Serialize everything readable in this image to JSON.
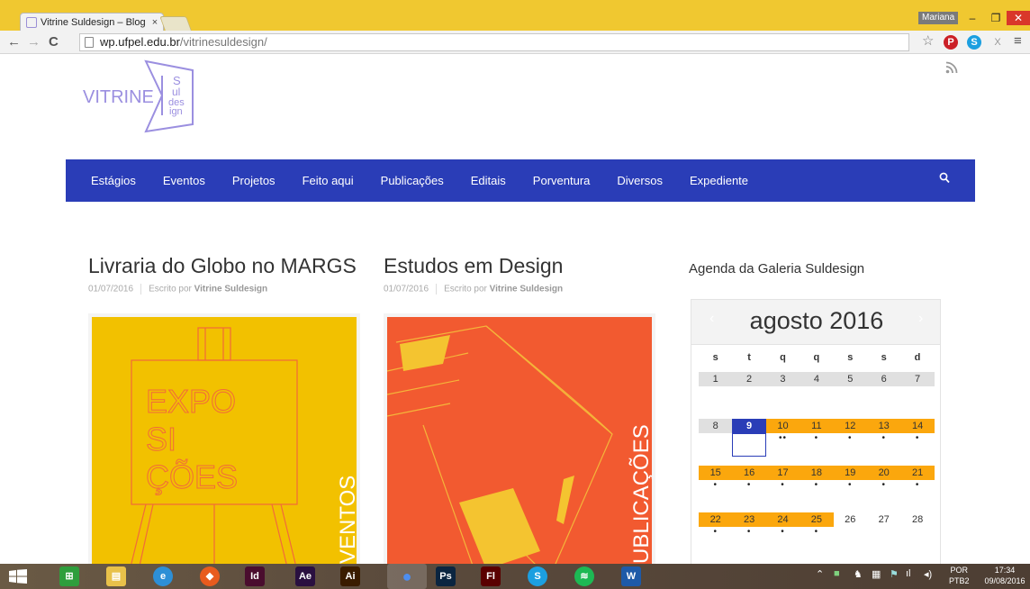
{
  "browser": {
    "tab_title": "Vitrine Suldesign – Blog d",
    "tab_close": "×",
    "user": "Mariana",
    "win_min": "‒",
    "win_max": "❐",
    "win_close": "✕",
    "back": "←",
    "forward": "→",
    "reload": "C",
    "url_host": "wp.ufpel.edu.br",
    "url_path": "/vitrinesuldesign/",
    "star": "☆",
    "ext_pinterest": "P",
    "ext_skype": "S",
    "ext_x": "X",
    "menu": "≡"
  },
  "site": {
    "logo_word": "VITRINE",
    "logo_stack": [
      "S",
      "ul",
      "des",
      "ign"
    ],
    "rss_icon": "rss-icon",
    "nav": [
      "Estágios",
      "Eventos",
      "Projetos",
      "Feito aqui",
      "Publicações",
      "Editais",
      "Porventura",
      "Diversos",
      "Expediente"
    ],
    "search_icon": "search-icon",
    "brand_color": "#2a3db7"
  },
  "posts": [
    {
      "title": "Livraria do Globo no MARGS",
      "date": "01/07/2016",
      "by": "Escrito por",
      "author": "Vitrine Suldesign",
      "thumb_color": "#f2c100",
      "thumb_lines": [
        "EXPO",
        "SI",
        "ÇÕES"
      ],
      "thumb_vertical": "EVENTOS"
    },
    {
      "title": "Estudos em Design",
      "date": "01/07/2016",
      "by": "Escrito por",
      "author": "Vitrine Suldesign",
      "thumb_color": "#f25a30",
      "thumb_vertical": "PUBLICAÇÕES"
    }
  ],
  "sidebar": {
    "title": "Agenda da Galeria Suldesign",
    "calendar": {
      "month": "agosto 2016",
      "prev": "‹",
      "next": "›",
      "dow": [
        "s",
        "t",
        "q",
        "q",
        "s",
        "s",
        "d"
      ],
      "weeks": [
        [
          {
            "d": "1"
          },
          {
            "d": "2"
          },
          {
            "d": "3"
          },
          {
            "d": "4"
          },
          {
            "d": "5"
          },
          {
            "d": "6"
          },
          {
            "d": "7"
          }
        ],
        [
          {
            "d": "8"
          },
          {
            "d": "9",
            "today": true
          },
          {
            "d": "10",
            "ev": true,
            "dots": "••"
          },
          {
            "d": "11",
            "ev": true,
            "dots": "•"
          },
          {
            "d": "12",
            "ev": true,
            "dots": "•"
          },
          {
            "d": "13",
            "ev": true,
            "dots": "•"
          },
          {
            "d": "14",
            "ev": true,
            "dots": "•"
          }
        ],
        [
          {
            "d": "15",
            "ev": true,
            "dots": "•"
          },
          {
            "d": "16",
            "ev": true,
            "dots": "•"
          },
          {
            "d": "17",
            "ev": true,
            "dots": "•"
          },
          {
            "d": "18",
            "ev": true,
            "dots": "•"
          },
          {
            "d": "19",
            "ev": true,
            "dots": "•"
          },
          {
            "d": "20",
            "ev": true,
            "dots": "•"
          },
          {
            "d": "21",
            "ev": true,
            "dots": "•"
          }
        ],
        [
          {
            "d": "22",
            "ev": true,
            "dots": "•"
          },
          {
            "d": "23",
            "ev": true,
            "dots": "•"
          },
          {
            "d": "24",
            "ev": true,
            "dots": "•"
          },
          {
            "d": "25",
            "ev": true,
            "dots": "•"
          },
          {
            "d": "26",
            "blank": true
          },
          {
            "d": "27",
            "blank": true
          },
          {
            "d": "28",
            "blank": true
          }
        ]
      ],
      "event_color": "#fba70d"
    }
  },
  "taskbar": {
    "apps": [
      {
        "name": "windows-start-icon",
        "label": "",
        "color": "transparent"
      },
      {
        "name": "store-icon",
        "label": "⊞",
        "color": "#2e9e3c"
      },
      {
        "name": "file-explorer-icon",
        "label": "▤",
        "color": "#e8c14a"
      },
      {
        "name": "internet-explorer-icon",
        "label": "e",
        "color": "#2d8fd6"
      },
      {
        "name": "brave-icon",
        "label": "◆",
        "color": "#e85b1e"
      },
      {
        "name": "indesign-icon",
        "label": "Id",
        "color": "#4a0d2e"
      },
      {
        "name": "after-effects-icon",
        "label": "Ae",
        "color": "#2a1040"
      },
      {
        "name": "illustrator-icon",
        "label": "Ai",
        "color": "#3a1c00"
      },
      {
        "name": "chrome-icon",
        "label": "●",
        "color": "#3a78d8"
      },
      {
        "name": "photoshop-icon",
        "label": "Ps",
        "color": "#0b2540"
      },
      {
        "name": "flash-icon",
        "label": "Fl",
        "color": "#5a0000"
      },
      {
        "name": "skype-icon",
        "label": "S",
        "color": "#1c9fe0"
      },
      {
        "name": "spotify-icon",
        "label": "≋",
        "color": "#1db954"
      },
      {
        "name": "word-icon",
        "label": "W",
        "color": "#1e5aa8"
      }
    ],
    "lang_top": "POR",
    "lang_bottom": "PTB2",
    "time": "17:34",
    "date": "09/08/2016"
  }
}
